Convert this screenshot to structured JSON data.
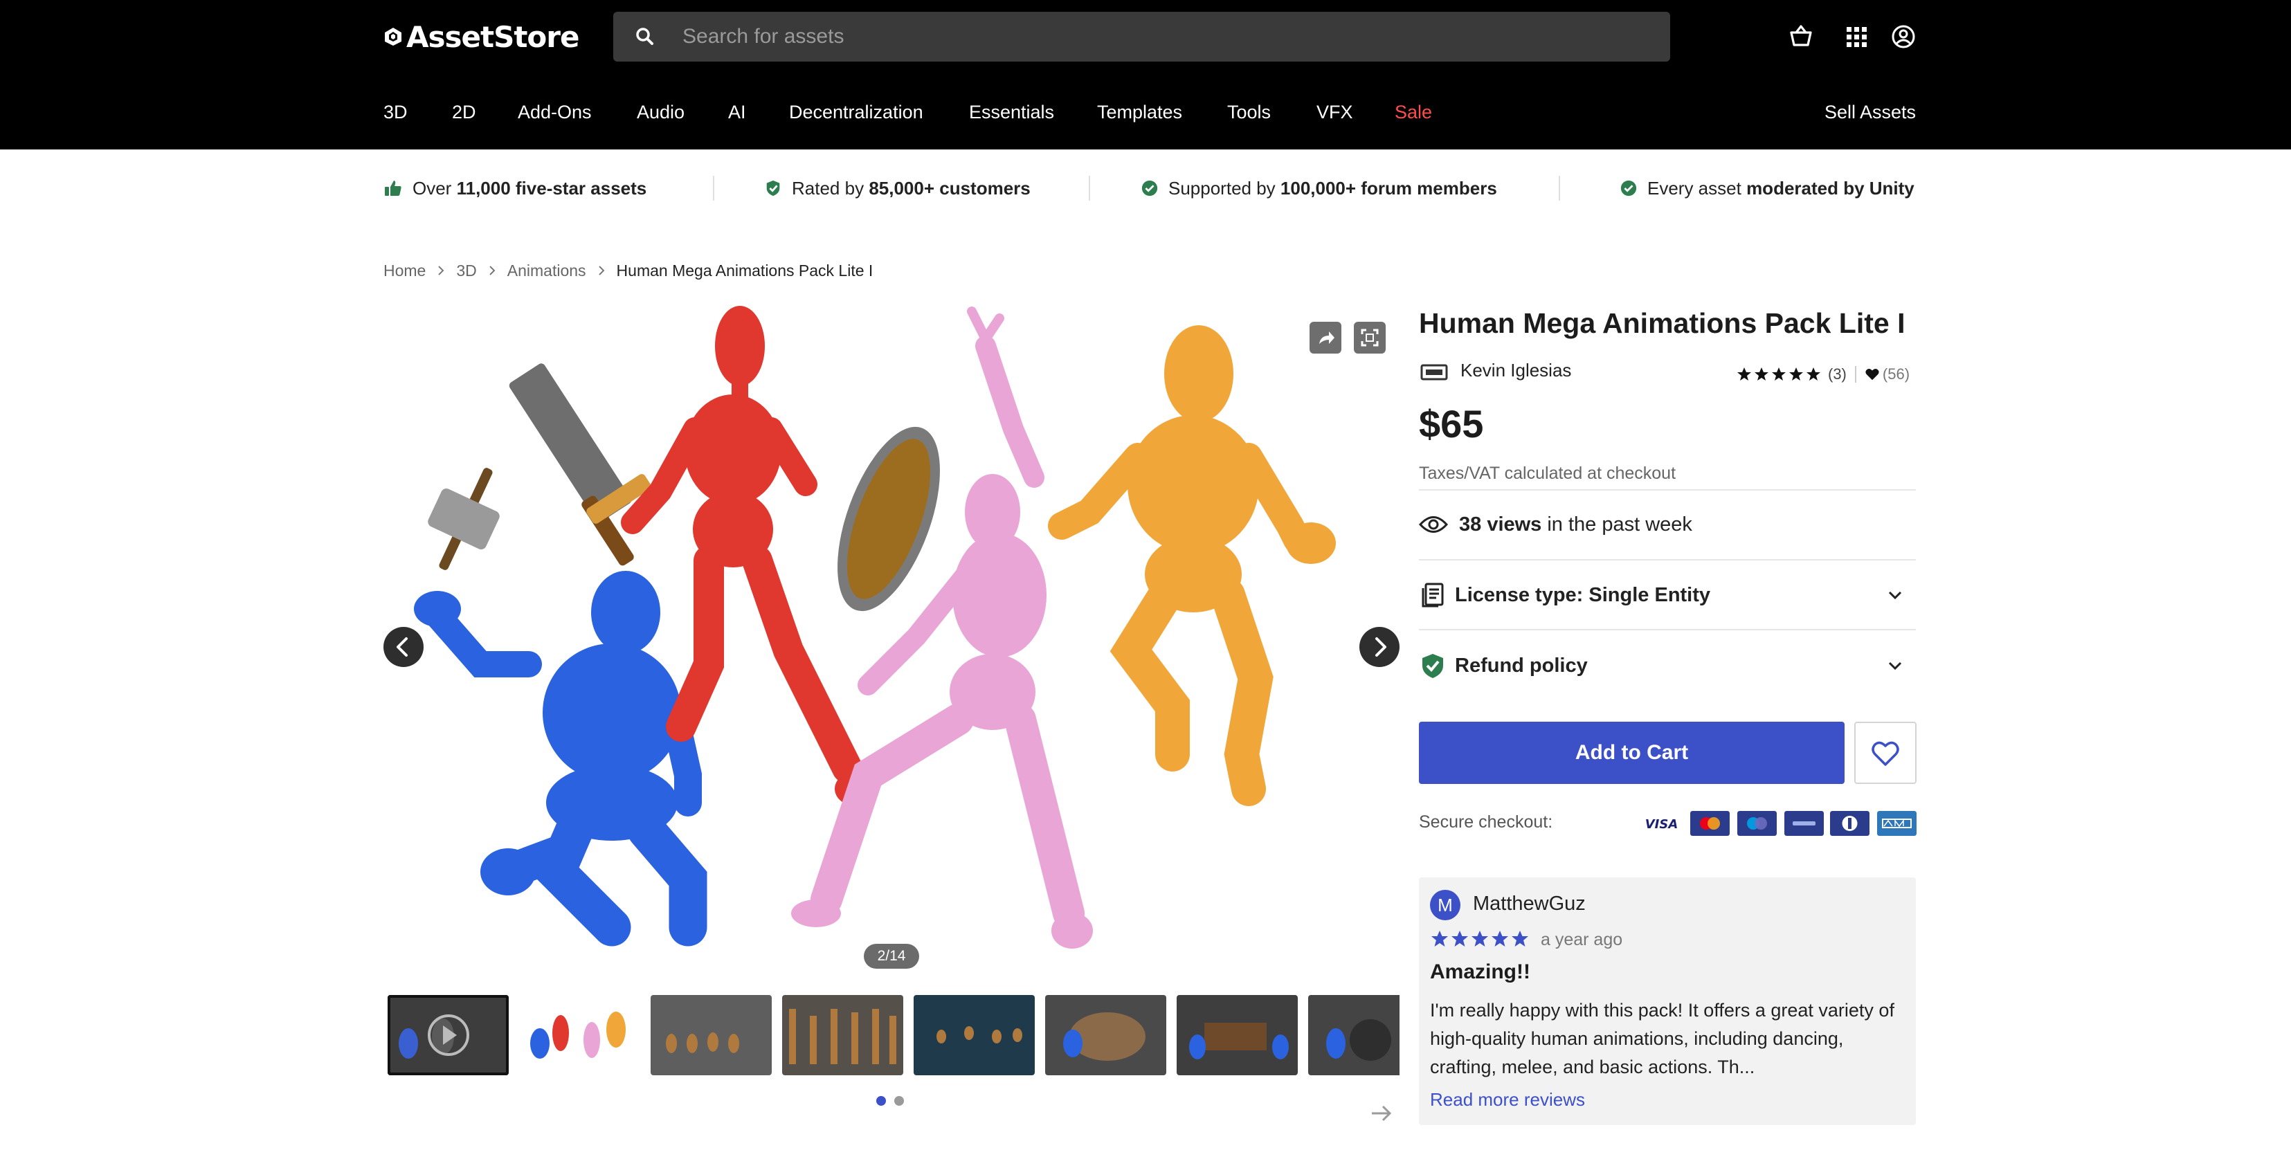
{
  "header": {
    "logo_text": "AssetStore",
    "search": {
      "placeholder": "Search for assets"
    },
    "icons": [
      "cart-icon",
      "apps-grid-icon",
      "account-icon"
    ]
  },
  "nav": {
    "items": [
      "3D",
      "2D",
      "Add-Ons",
      "Audio",
      "AI",
      "Decentralization",
      "Essentials",
      "Templates",
      "Tools",
      "VFX",
      "Sale"
    ],
    "sell": "Sell Assets",
    "sale_color": "#ff4d4d"
  },
  "trust": {
    "items": [
      {
        "prefix": "Over",
        "bold": "11,000 five-star assets",
        "suffix": "",
        "icon": "thumbs-up-icon"
      },
      {
        "prefix": "Rated by",
        "bold": "85,000+ customers",
        "suffix": "",
        "icon": "check-shield-icon"
      },
      {
        "prefix": "Supported by",
        "bold": "100,000+ forum members",
        "suffix": "",
        "icon": "check-shield-icon"
      },
      {
        "prefix": "Every asset",
        "bold": "moderated by Unity",
        "suffix": "",
        "icon": "check-shield-icon"
      }
    ],
    "icon_color": "#2e7d4f"
  },
  "breadcrumb": [
    "Home",
    "3D",
    "Animations",
    "Human Mega Animations Pack Lite I"
  ],
  "gallery": {
    "counter": "2/14",
    "active_thumb": 0,
    "thumb_count": 8,
    "current_page_dot": 0,
    "page_dots": 2
  },
  "product": {
    "title": "Human Mega Animations Pack Lite I",
    "publisher": "Kevin Iglesias",
    "rating_count": "(3)",
    "favorites": "(56)",
    "rating": 5,
    "price": "$65",
    "tax_note": "Taxes/VAT calculated at checkout",
    "views_count": "38 views",
    "views_suffix": "in the past week",
    "license": "License type: Single Entity",
    "refund": "Refund policy",
    "add_to_cart": "Add to Cart",
    "secure_checkout": "Secure checkout:",
    "payment_methods": [
      "visa",
      "mastercard",
      "maestro",
      "paypal",
      "diners",
      "amex"
    ],
    "accent": "#3c50c8"
  },
  "review": {
    "initial": "M",
    "name": "MatthewGuz",
    "rating": 5,
    "time": "a year ago",
    "title": "Amazing!!",
    "body": "I'm really happy with this pack! It offers a great variety of high-quality human animations, including dancing, crafting, melee, and basic actions. Th...",
    "more": "Read more reviews"
  }
}
